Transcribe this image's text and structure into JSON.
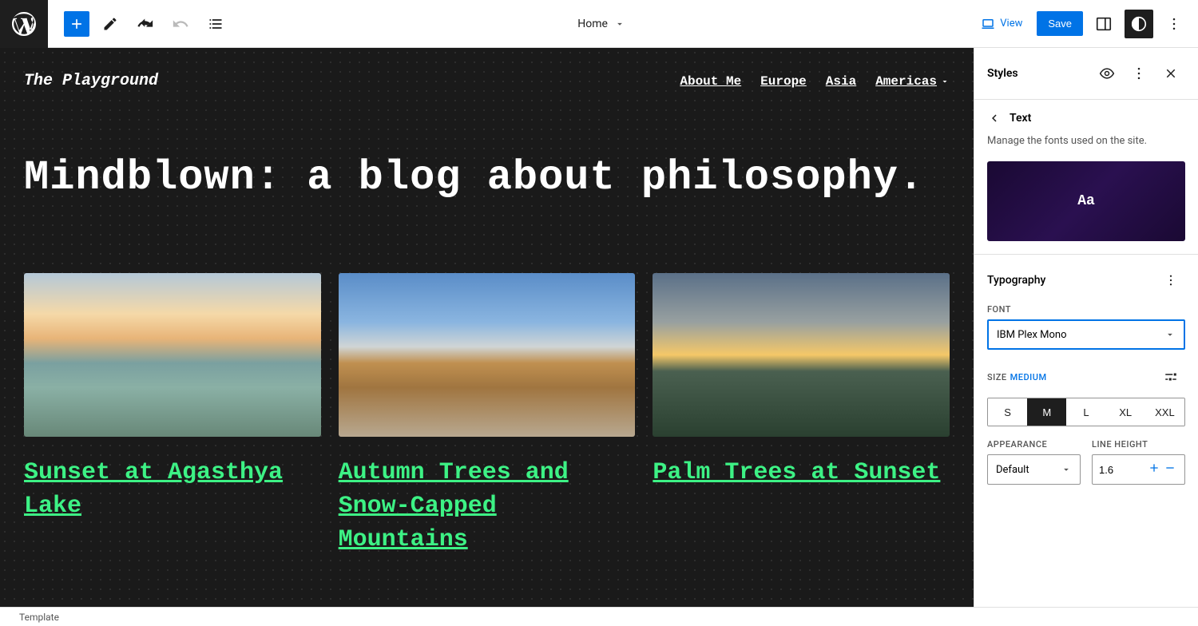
{
  "toolbar": {
    "page_title": "Home",
    "view_label": "View",
    "save_label": "Save"
  },
  "canvas": {
    "site_title": "The Playground",
    "nav": [
      "About Me",
      "Europe",
      "Asia",
      "Americas"
    ],
    "hero": "Mindblown: a blog about philosophy.",
    "posts": [
      {
        "title": "Sunset at Agasthya Lake"
      },
      {
        "title": "Autumn Trees and Snow-Capped Mountains"
      },
      {
        "title": "Palm Trees at Sunset"
      }
    ]
  },
  "sidebar": {
    "title": "Styles",
    "breadcrumb": "Text",
    "description": "Manage the fonts used on the site.",
    "preview_text": "Aa",
    "typography": {
      "section_title": "Typography",
      "font_label": "FONT",
      "font_value": "IBM Plex Mono",
      "size_label": "SIZE",
      "size_current": "MEDIUM",
      "size_options": [
        "S",
        "M",
        "L",
        "XL",
        "XXL"
      ],
      "size_active_index": 1,
      "appearance_label": "APPEARANCE",
      "appearance_value": "Default",
      "line_height_label": "LINE HEIGHT",
      "line_height_value": "1.6"
    }
  },
  "footer": {
    "template": "Template"
  }
}
